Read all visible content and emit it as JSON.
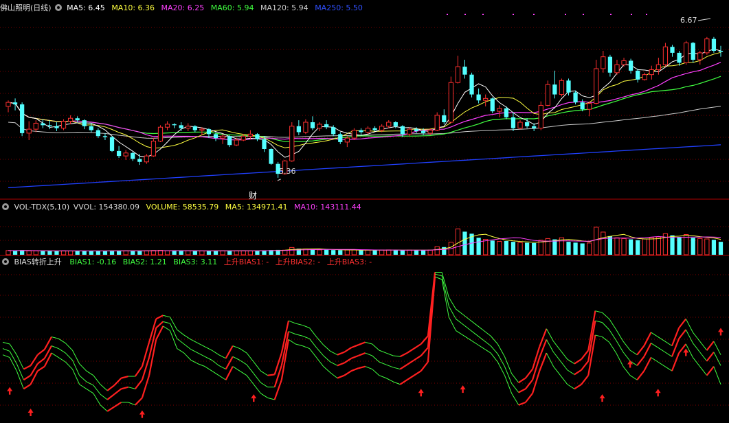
{
  "colors": {
    "up": "#ff3030",
    "down": "#54ffff",
    "ma5": "#ffffff",
    "ma10": "#ffff40",
    "ma20": "#ff40ff",
    "ma60": "#40ff40",
    "ma120": "#cccccc",
    "ma250": "#2040ff",
    "grid": "#800000",
    "bias_green": "#40ff40",
    "bias_red": "#ff2020"
  },
  "price_panel": {
    "title": "佛山照明(日线)",
    "ma5": "MA5: 6.45",
    "ma10": "MA10: 6.36",
    "ma20": "MA20: 6.25",
    "ma60": "MA60: 5.94",
    "ma120": "MA120: 5.94",
    "ma250": "MA250: 5.50",
    "high_note": "6.67",
    "low_note": "5.36",
    "event_marker": "财"
  },
  "volume_panel": {
    "title": "VOL-TDX(5,10)",
    "vvol": "VVOL: 154380.09",
    "volume": "VOLUME: 58535.79",
    "ma5": "MA5: 134971.41",
    "ma10": "MA10: 143111.44"
  },
  "bias_panel": {
    "title": "BIAS转折上升",
    "bias1": "BIAS1: -0.16",
    "bias2": "BIAS2: 1.21",
    "bias3": "BIAS3: 3.11",
    "up1": "上升BIAS1: -",
    "up2": "上升BIAS2: -",
    "up3": "上升BIAS3: -"
  },
  "chart_data": {
    "type": "candlestick",
    "price_range": [
      5.2,
      7.0
    ],
    "candles": [
      [
        6.08,
        6.14,
        6.02,
        6.12
      ],
      [
        6.12,
        6.16,
        6.04,
        6.1
      ],
      [
        6.1,
        6.12,
        5.78,
        5.81
      ],
      [
        5.81,
        5.93,
        5.74,
        5.85
      ],
      [
        5.85,
        5.94,
        5.82,
        5.91
      ],
      [
        5.91,
        5.95,
        5.86,
        5.89
      ],
      [
        5.89,
        5.94,
        5.85,
        5.88
      ],
      [
        5.88,
        5.92,
        5.83,
        5.86
      ],
      [
        5.86,
        5.95,
        5.84,
        5.93
      ],
      [
        5.93,
        5.99,
        5.9,
        5.96
      ],
      [
        5.96,
        5.98,
        5.92,
        5.94
      ],
      [
        5.94,
        5.95,
        5.85,
        5.88
      ],
      [
        5.88,
        5.91,
        5.82,
        5.84
      ],
      [
        5.84,
        5.86,
        5.76,
        5.78
      ],
      [
        5.78,
        5.81,
        5.74,
        5.77
      ],
      [
        5.77,
        5.78,
        5.62,
        5.63
      ],
      [
        5.63,
        5.68,
        5.56,
        5.58
      ],
      [
        5.58,
        5.64,
        5.54,
        5.61
      ],
      [
        5.61,
        5.62,
        5.53,
        5.55
      ],
      [
        5.55,
        5.6,
        5.49,
        5.52
      ],
      [
        5.52,
        5.6,
        5.5,
        5.58
      ],
      [
        5.58,
        5.76,
        5.57,
        5.73
      ],
      [
        5.73,
        5.89,
        5.72,
        5.87
      ],
      [
        5.87,
        5.93,
        5.84,
        5.9
      ],
      [
        5.9,
        5.91,
        5.86,
        5.89
      ],
      [
        5.89,
        5.92,
        5.83,
        5.86
      ],
      [
        5.86,
        5.91,
        5.83,
        5.88
      ],
      [
        5.88,
        5.89,
        5.82,
        5.84
      ],
      [
        5.84,
        5.87,
        5.79,
        5.85
      ],
      [
        5.85,
        5.86,
        5.76,
        5.8
      ],
      [
        5.8,
        5.82,
        5.73,
        5.76
      ],
      [
        5.76,
        5.8,
        5.7,
        5.78
      ],
      [
        5.78,
        5.79,
        5.67,
        5.69
      ],
      [
        5.69,
        5.76,
        5.68,
        5.74
      ],
      [
        5.74,
        5.8,
        5.73,
        5.78
      ],
      [
        5.78,
        5.84,
        5.75,
        5.8
      ],
      [
        5.8,
        5.81,
        5.73,
        5.75
      ],
      [
        5.75,
        5.78,
        5.62,
        5.65
      ],
      [
        5.65,
        5.66,
        5.49,
        5.5
      ],
      [
        5.5,
        5.52,
        5.36,
        5.4
      ],
      [
        5.4,
        5.54,
        5.39,
        5.53
      ],
      [
        5.53,
        5.92,
        5.52,
        5.88
      ],
      [
        5.88,
        5.94,
        5.79,
        5.82
      ],
      [
        5.82,
        5.95,
        5.8,
        5.92
      ],
      [
        5.92,
        5.98,
        5.84,
        5.86
      ],
      [
        5.86,
        5.92,
        5.83,
        5.9
      ],
      [
        5.9,
        5.94,
        5.85,
        5.87
      ],
      [
        5.87,
        5.89,
        5.78,
        5.8
      ],
      [
        5.8,
        5.82,
        5.7,
        5.72
      ],
      [
        5.72,
        5.78,
        5.67,
        5.76
      ],
      [
        5.76,
        5.86,
        5.74,
        5.84
      ],
      [
        5.84,
        5.86,
        5.79,
        5.82
      ],
      [
        5.82,
        5.88,
        5.8,
        5.86
      ],
      [
        5.86,
        5.88,
        5.83,
        5.84
      ],
      [
        5.84,
        5.9,
        5.82,
        5.88
      ],
      [
        5.88,
        5.94,
        5.86,
        5.92
      ],
      [
        5.92,
        5.93,
        5.86,
        5.88
      ],
      [
        5.88,
        5.89,
        5.77,
        5.8
      ],
      [
        5.8,
        5.87,
        5.78,
        5.85
      ],
      [
        5.85,
        5.87,
        5.81,
        5.83
      ],
      [
        5.83,
        5.86,
        5.79,
        5.81
      ],
      [
        5.81,
        5.86,
        5.79,
        5.84
      ],
      [
        5.84,
        6.02,
        5.83,
        5.99
      ],
      [
        5.99,
        6.05,
        5.9,
        5.92
      ],
      [
        5.92,
        6.38,
        5.91,
        6.32
      ],
      [
        6.32,
        6.59,
        6.31,
        6.48
      ],
      [
        6.48,
        6.55,
        6.36,
        6.4
      ],
      [
        6.4,
        6.42,
        6.17,
        6.2
      ],
      [
        6.2,
        6.26,
        6.11,
        6.14
      ],
      [
        6.14,
        6.2,
        6.08,
        6.16
      ],
      [
        6.16,
        6.17,
        6.01,
        6.03
      ],
      [
        6.03,
        6.09,
        5.97,
        6.06
      ],
      [
        6.06,
        6.08,
        5.95,
        5.97
      ],
      [
        5.97,
        6.02,
        5.83,
        5.86
      ],
      [
        5.86,
        5.94,
        5.85,
        5.92
      ],
      [
        5.92,
        5.96,
        5.86,
        5.88
      ],
      [
        5.88,
        5.91,
        5.83,
        5.86
      ],
      [
        5.86,
        6.13,
        5.84,
        6.09
      ],
      [
        6.09,
        6.34,
        6.08,
        6.3
      ],
      [
        6.3,
        6.44,
        6.16,
        6.2
      ],
      [
        6.2,
        6.36,
        6.18,
        6.34
      ],
      [
        6.34,
        6.36,
        6.19,
        6.22
      ],
      [
        6.22,
        6.24,
        6.1,
        6.12
      ],
      [
        6.12,
        6.15,
        6.03,
        6.05
      ],
      [
        6.05,
        6.13,
        5.98,
        6.11
      ],
      [
        6.11,
        6.55,
        6.1,
        6.46
      ],
      [
        6.46,
        6.64,
        6.42,
        6.58
      ],
      [
        6.58,
        6.6,
        6.38,
        6.42
      ],
      [
        6.42,
        6.55,
        6.4,
        6.5
      ],
      [
        6.5,
        6.57,
        6.48,
        6.54
      ],
      [
        6.54,
        6.56,
        6.41,
        6.44
      ],
      [
        6.44,
        6.46,
        6.32,
        6.35
      ],
      [
        6.35,
        6.42,
        6.34,
        6.4
      ],
      [
        6.4,
        6.49,
        6.35,
        6.45
      ],
      [
        6.45,
        6.57,
        6.4,
        6.5
      ],
      [
        6.5,
        6.72,
        6.48,
        6.68
      ],
      [
        6.68,
        6.7,
        6.58,
        6.62
      ],
      [
        6.62,
        6.64,
        6.49,
        6.52
      ],
      [
        6.52,
        6.74,
        6.5,
        6.72
      ],
      [
        6.72,
        6.73,
        6.52,
        6.55
      ],
      [
        6.55,
        6.64,
        6.5,
        6.62
      ],
      [
        6.62,
        6.78,
        6.6,
        6.76
      ],
      [
        6.76,
        6.78,
        6.62,
        6.64
      ],
      [
        6.64,
        6.69,
        6.58,
        6.63
      ]
    ],
    "volume_range": [
      0,
      500000
    ],
    "volume": [
      52000,
      50000,
      56000,
      48000,
      47000,
      46000,
      48000,
      45000,
      49000,
      47000,
      46000,
      48000,
      47000,
      50000,
      46000,
      52000,
      49000,
      48000,
      51000,
      47000,
      50000,
      53000,
      55000,
      50000,
      48000,
      47000,
      49000,
      46000,
      48000,
      47000,
      50000,
      49000,
      52000,
      48000,
      49000,
      47000,
      51000,
      55000,
      58000,
      60000,
      57000,
      90000,
      75000,
      72000,
      68000,
      60000,
      62000,
      58000,
      57000,
      59000,
      60000,
      56000,
      58000,
      57000,
      59000,
      60000,
      58000,
      56000,
      57000,
      55000,
      56000,
      58000,
      100000,
      95000,
      155000,
      320000,
      285000,
      260000,
      210000,
      190000,
      175000,
      165000,
      170000,
      160000,
      150000,
      148000,
      145000,
      180000,
      200000,
      190000,
      210000,
      160000,
      150000,
      140000,
      145000,
      340000,
      280000,
      230000,
      210000,
      200000,
      190000,
      180000,
      195000,
      210000,
      220000,
      260000,
      240000,
      220000,
      250000,
      210000,
      200000,
      195000,
      185000,
      160000
    ],
    "bias_range": [
      -8.5,
      8.5
    ],
    "bias1": [
      -1.2,
      -1.5,
      -3.0,
      -5.0,
      -4.5,
      -3.0,
      -2.5,
      -1.0,
      -1.5,
      -2.0,
      -2.8,
      -4.5,
      -5.0,
      -5.5,
      -6.8,
      -7.5,
      -7.0,
      -6.5,
      -6.5,
      -6.8,
      -6.0,
      -3.5,
      0.5,
      2.0,
      1.5,
      -0.5,
      -1.0,
      -1.8,
      -2.2,
      -2.5,
      -3.0,
      -3.5,
      -4.0,
      -2.5,
      -3.0,
      -3.5,
      -4.5,
      -5.5,
      -6.0,
      -6.2,
      -4.0,
      0.5,
      0.0,
      -0.2,
      -0.5,
      -1.5,
      -2.5,
      -3.2,
      -3.8,
      -3.5,
      -3.0,
      -2.7,
      -2.5,
      -2.8,
      -3.5,
      -3.8,
      -4.2,
      -4.5,
      -4.0,
      -3.5,
      -3.0,
      -2.0,
      7.5,
      7.2,
      3.0,
      1.5,
      1.0,
      0.5,
      0.0,
      -0.5,
      -1.0,
      -2.0,
      -3.5,
      -5.5,
      -6.8,
      -6.5,
      -5.5,
      -3.0,
      -1.0,
      -2.5,
      -3.5,
      -4.5,
      -5.0,
      -4.5,
      -3.5,
      1.0,
      0.8,
      0.2,
      -1.0,
      -2.5,
      -3.5,
      -4.0,
      -3.0,
      -1.5,
      -2.0,
      -2.5,
      -3.0,
      -1.0,
      0.0,
      -1.5,
      -2.5,
      -3.5,
      -2.5,
      -4.5
    ],
    "bias2": [
      -0.5,
      -0.8,
      -2.2,
      -4.0,
      -3.5,
      -2.2,
      -1.6,
      -0.2,
      -0.5,
      -1.0,
      -1.8,
      -3.5,
      -4.2,
      -4.6,
      -5.6,
      -6.2,
      -5.6,
      -5.0,
      -4.8,
      -5.0,
      -4.0,
      -1.5,
      1.8,
      2.5,
      2.3,
      0.6,
      0.0,
      -0.6,
      -1.0,
      -1.4,
      -1.8,
      -2.4,
      -2.8,
      -1.4,
      -1.8,
      -2.3,
      -3.3,
      -4.3,
      -4.8,
      -4.8,
      -2.4,
      1.4,
      1.1,
      0.9,
      0.6,
      -0.4,
      -1.3,
      -2.0,
      -2.4,
      -2.1,
      -1.6,
      -1.3,
      -1.0,
      -1.3,
      -2.0,
      -2.3,
      -2.6,
      -2.8,
      -2.3,
      -1.8,
      -1.3,
      -0.4,
      7.8,
      7.6,
      4.2,
      2.8,
      2.2,
      1.6,
      1.0,
      0.4,
      -0.2,
      -1.1,
      -2.5,
      -4.4,
      -5.4,
      -5.0,
      -4.0,
      -1.5,
      0.5,
      -0.9,
      -1.9,
      -2.9,
      -3.4,
      -2.9,
      -1.9,
      2.6,
      2.4,
      1.6,
      0.4,
      -0.9,
      -1.9,
      -2.4,
      -1.4,
      0.1,
      -0.4,
      -0.9,
      -1.4,
      0.6,
      1.6,
      0.1,
      -0.9,
      -1.9,
      -0.9,
      -2.4
    ],
    "bias3": [
      0.2,
      0.0,
      -1.2,
      -2.8,
      -2.4,
      -1.2,
      -0.6,
      0.8,
      0.6,
      0.1,
      -0.7,
      -2.2,
      -3.0,
      -3.5,
      -4.5,
      -5.2,
      -4.6,
      -3.8,
      -3.6,
      -3.6,
      -2.5,
      0.2,
      2.8,
      3.2,
      3.0,
      1.6,
      1.0,
      0.5,
      0.1,
      -0.3,
      -0.7,
      -1.2,
      -1.6,
      -0.2,
      -0.5,
      -1.0,
      -2.0,
      -3.0,
      -3.5,
      -3.4,
      -1.0,
      2.6,
      2.3,
      2.1,
      1.8,
      0.8,
      -0.1,
      -0.8,
      -1.2,
      -0.9,
      -0.4,
      -0.1,
      0.2,
      0.0,
      -0.7,
      -1.0,
      -1.3,
      -1.4,
      -1.0,
      -0.5,
      0.0,
      0.9,
      8.0,
      8.0,
      5.2,
      3.9,
      3.3,
      2.7,
      2.1,
      1.5,
      0.9,
      0.0,
      -1.4,
      -3.3,
      -4.3,
      -3.8,
      -2.8,
      -0.3,
      1.7,
      0.3,
      -0.7,
      -1.7,
      -2.2,
      -1.7,
      -0.7,
      3.7,
      3.5,
      2.8,
      1.6,
      0.3,
      -0.7,
      -1.2,
      -0.2,
      1.3,
      0.8,
      0.3,
      -0.2,
      1.8,
      2.8,
      1.3,
      0.3,
      -0.7,
      0.3,
      -1.2
    ],
    "up_arrows": [
      [
        1,
        -4.8
      ],
      [
        8,
        -7.2
      ],
      [
        38,
        -7.4
      ],
      [
        69,
        -5.6
      ],
      [
        115,
        -5.0
      ],
      [
        126,
        -4.6
      ],
      [
        164,
        -5.6
      ],
      [
        180,
        -5.0
      ],
      [
        173,
        -1.8
      ],
      [
        188,
        -0.5
      ],
      [
        197,
        1.8
      ]
    ]
  }
}
